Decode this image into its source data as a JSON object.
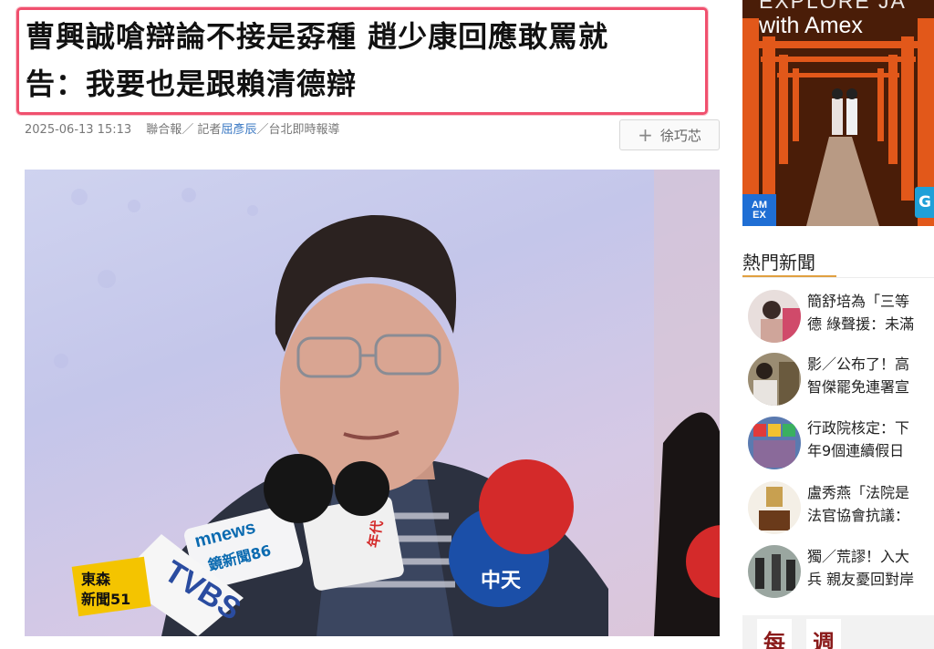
{
  "article": {
    "title_line1": "曹興誠嗆辯論不接是孬種 趙少康回應敢罵就",
    "title_line2": "告：我要也是跟賴清德辯",
    "date": "2025-06-13 15:13",
    "source": "聯合報／ 記者",
    "reporter": "屈彥辰",
    "location": "／台北即時報導",
    "follow_icon": "+",
    "follow_label": "徐巧芯"
  },
  "photo": {
    "mic_labels": {
      "mnews": "mnews",
      "mnews_sub": "鏡新聞86",
      "tvbs": "TVBS",
      "eastern": "東森",
      "eastern_sub": "新聞51",
      "ctitv": "中天",
      "era": "年代"
    }
  },
  "ad": {
    "top_text": "EXPLORE JA",
    "title": "with Amex",
    "logo_line1": "AM",
    "logo_line2": "EX",
    "edge_label": "G"
  },
  "hot_news": {
    "heading": "熱門新聞",
    "items": [
      {
        "line1": "簡舒培為「三等",
        "line2": "德 綠聲援：未滿"
      },
      {
        "line1": "影／公布了！高",
        "line2": "智傑罷免連署宣"
      },
      {
        "line1": "行政院核定：下",
        "line2": "年9個連續假日"
      },
      {
        "line1": "盧秀燕「法院是",
        "line2": "法官協會抗議："
      },
      {
        "line1": "獨／荒謬！入大",
        "line2": "兵 親友憂回對岸"
      }
    ]
  },
  "weekly": {
    "char1": "每",
    "char2": "週"
  },
  "colors": {
    "headline_border": "#f0506e",
    "reporter_link": "#3a78c3",
    "section_underline": "#e0a040",
    "amex_blue": "#1f6ed4"
  }
}
